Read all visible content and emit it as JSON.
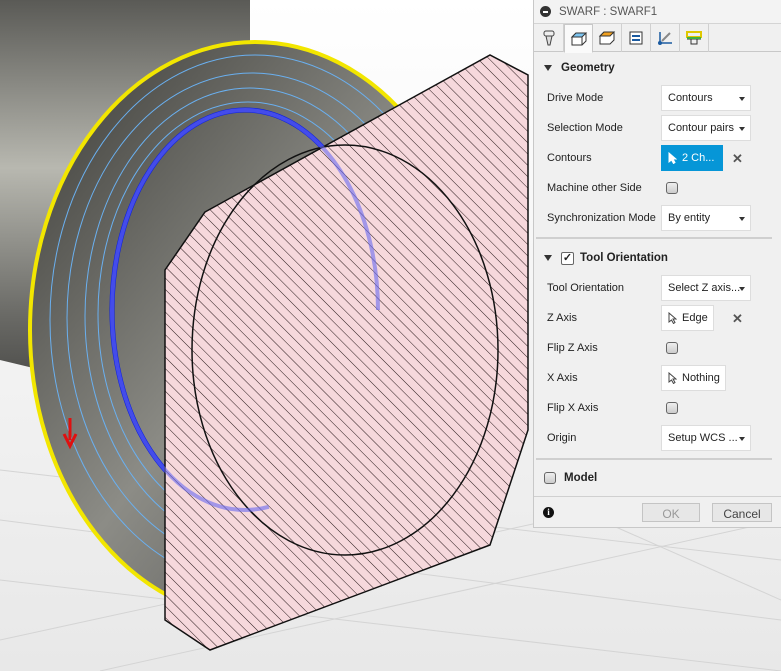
{
  "panel": {
    "title": "SWARF : SWARF1",
    "tabs": [
      {
        "icon": "tool-icon"
      },
      {
        "icon": "geometry-icon"
      },
      {
        "icon": "heights-icon"
      },
      {
        "icon": "passes-icon"
      },
      {
        "icon": "linking-icon"
      },
      {
        "icon": "stock-icon"
      }
    ],
    "geometry": {
      "header": "Geometry",
      "drive_mode": {
        "label": "Drive Mode",
        "value": "Contours"
      },
      "selection_mode": {
        "label": "Selection Mode",
        "value": "Contour pairs"
      },
      "contours": {
        "label": "Contours",
        "value": "2 Ch..."
      },
      "machine_other_side": {
        "label": "Machine other Side",
        "checked": false
      },
      "sync_mode": {
        "label": "Synchronization Mode",
        "value": "By entity"
      }
    },
    "tool_orientation": {
      "header": "Tool Orientation",
      "enabled": true,
      "tool_orientation": {
        "label": "Tool Orientation",
        "value": "Select Z axis..."
      },
      "z_axis": {
        "label": "Z Axis",
        "value": "Edge"
      },
      "flip_z": {
        "label": "Flip Z Axis",
        "checked": false
      },
      "x_axis": {
        "label": "X Axis",
        "value": "Nothing"
      },
      "flip_x": {
        "label": "Flip X Axis",
        "checked": false
      },
      "origin": {
        "label": "Origin",
        "value": "Setup WCS ..."
      }
    },
    "model": {
      "label": "Model",
      "checked": false
    },
    "ok": "OK",
    "cancel": "Cancel"
  },
  "colors": {
    "accent": "#0696d7",
    "contour_yellow": "#f2e600",
    "contour_blue": "#0a1ee0",
    "plate": "#f6d8dc"
  }
}
